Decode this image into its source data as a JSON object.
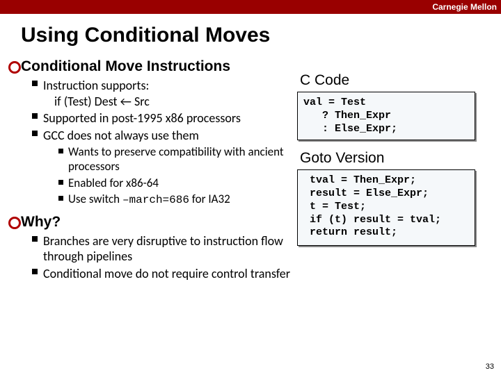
{
  "brand": "Carnegie Mellon",
  "title": "Using Conditional Moves",
  "section1": {
    "heading": "Conditional Move Instructions",
    "b1_a": "Instruction supports:",
    "b1_a_line": "if (Test) Dest ← Src",
    "b1_b": "Supported in post-1995 x86 processors",
    "b1_c": "GCC does not always use them",
    "b2_a": "Wants to preserve compatibility with ancient processors",
    "b2_b": "Enabled for x86-64",
    "b2_c_pre": "Use switch ",
    "b2_c_code": "–march=686",
    "b2_c_post": " for IA32"
  },
  "section2": {
    "heading": "Why?",
    "b1_a": "Branches are very disruptive to instruction flow through pipelines",
    "b1_b": "Conditional move do not require control transfer"
  },
  "right": {
    "h_ccode": "C Code",
    "code1": "val = Test\n   ? Then_Expr\n   : Else_Expr;",
    "h_goto": "Goto Version",
    "code2": " tval = Then_Expr;\n result = Else_Expr;\n t = Test;\n if (t) result = tval;\n return result;"
  },
  "slidenum": "33"
}
